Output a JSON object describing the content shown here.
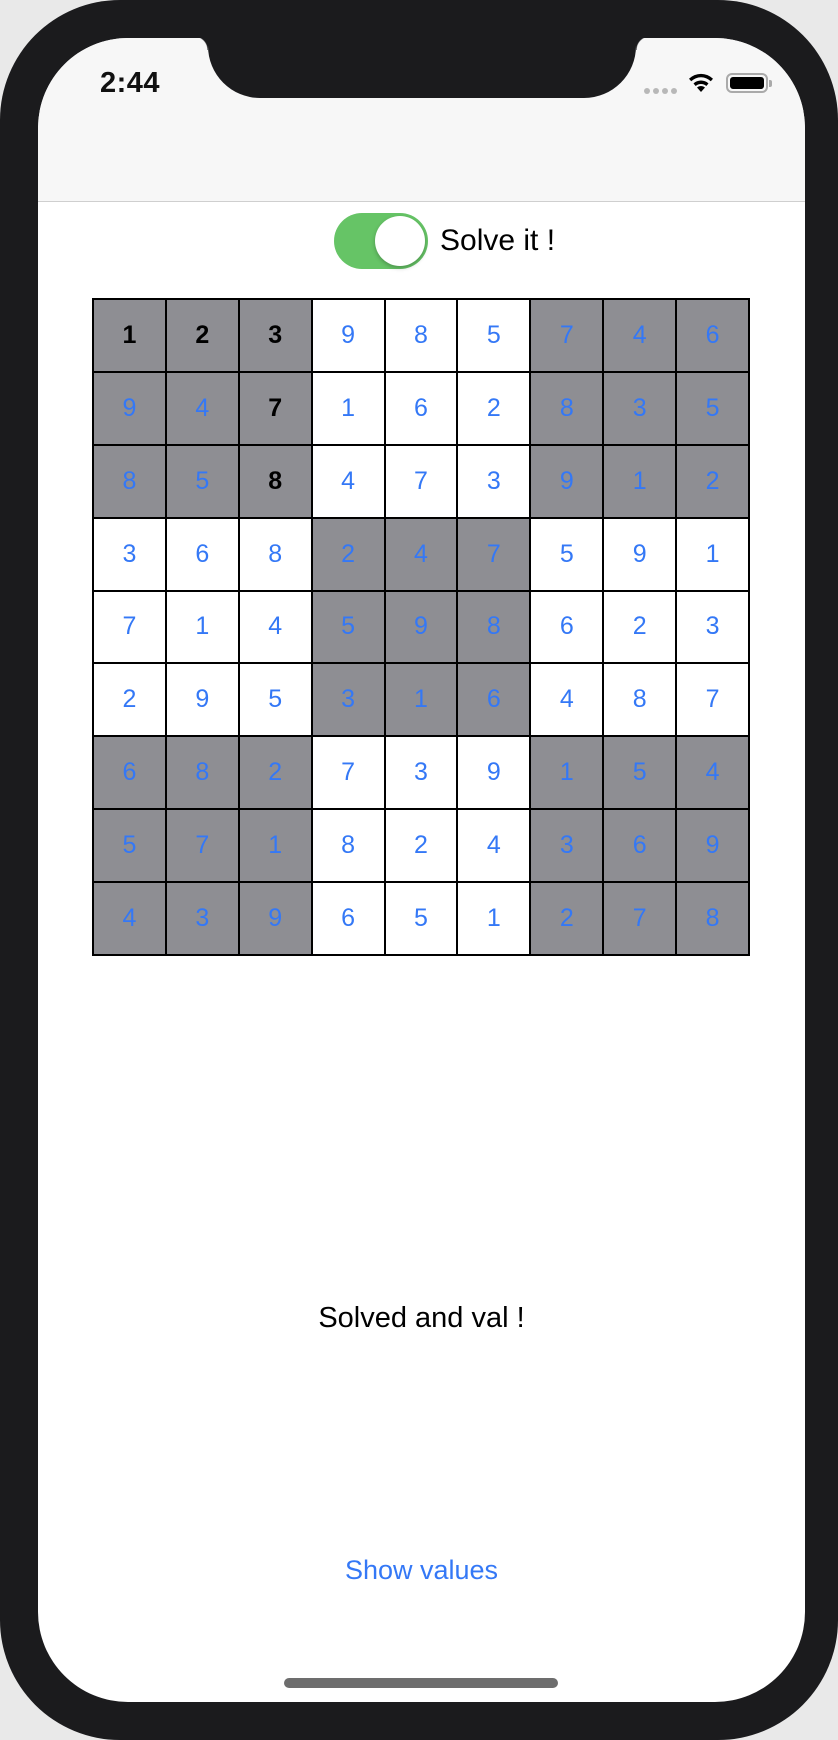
{
  "status_bar": {
    "time": "2:44"
  },
  "toggle": {
    "label": "Solve it !",
    "on": true,
    "color": "#66c466"
  },
  "board": {
    "rows": [
      [
        "1",
        "2",
        "3",
        "9",
        "8",
        "5",
        "7",
        "4",
        "6"
      ],
      [
        "9",
        "4",
        "7",
        "1",
        "6",
        "2",
        "8",
        "3",
        "5"
      ],
      [
        "8",
        "5",
        "8",
        "4",
        "7",
        "3",
        "9",
        "1",
        "2"
      ],
      [
        "3",
        "6",
        "8",
        "2",
        "4",
        "7",
        "5",
        "9",
        "1"
      ],
      [
        "7",
        "1",
        "4",
        "5",
        "9",
        "8",
        "6",
        "2",
        "3"
      ],
      [
        "2",
        "9",
        "5",
        "3",
        "1",
        "6",
        "4",
        "8",
        "7"
      ],
      [
        "6",
        "8",
        "2",
        "7",
        "3",
        "9",
        "1",
        "5",
        "4"
      ],
      [
        "5",
        "7",
        "1",
        "8",
        "2",
        "4",
        "3",
        "6",
        "9"
      ],
      [
        "4",
        "3",
        "9",
        "6",
        "5",
        "1",
        "2",
        "7",
        "8"
      ]
    ],
    "given": [
      [
        0,
        0
      ],
      [
        0,
        1
      ],
      [
        0,
        2
      ],
      [
        1,
        2
      ],
      [
        2,
        2
      ]
    ],
    "colors": {
      "shaded": "#8e8e93",
      "light": "#ffffff",
      "value_text": "#3478f6",
      "given_text": "#000000"
    }
  },
  "status_text": "Solved and val !",
  "show_values_label": "Show values"
}
